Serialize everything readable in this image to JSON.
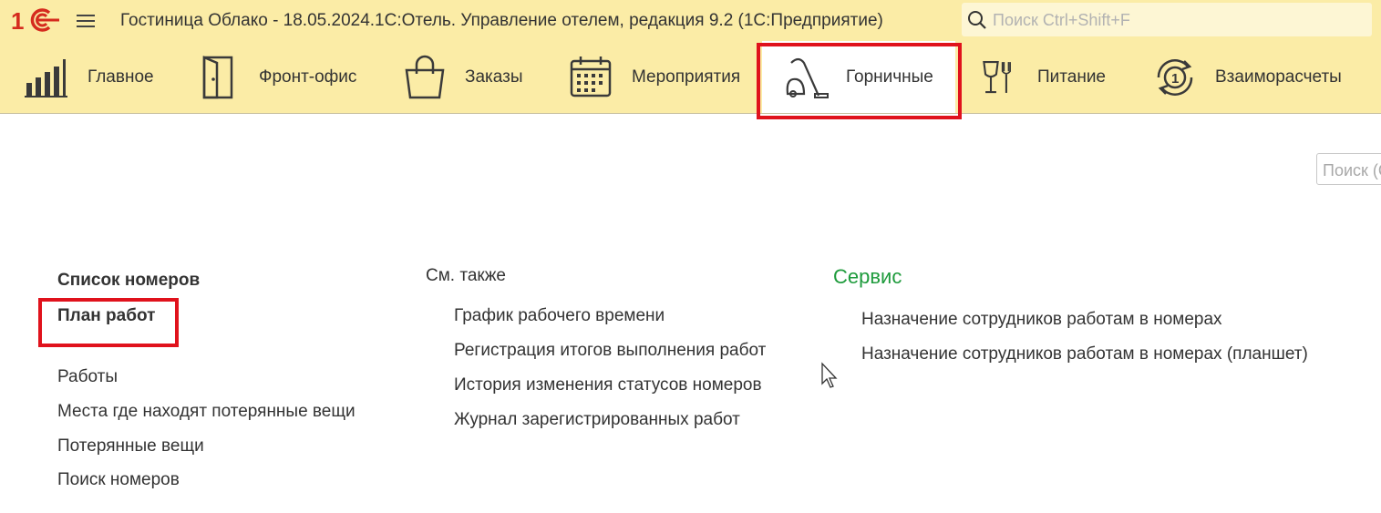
{
  "titlebar": {
    "title": "Гостиница Облако - 18.05.2024.1С:Отель. Управление отелем, редакция 9.2  (1С:Предприятие)",
    "logo_icon": "1c-logo-icon",
    "menu_icon": "hamburger-menu-icon",
    "search_placeholder": "Поиск Ctrl+Shift+F",
    "search_value": ""
  },
  "sections": [
    {
      "label": "Главное",
      "icon": "bar-chart-icon",
      "active": false
    },
    {
      "label": "Фронт-офис",
      "icon": "door-icon",
      "active": false
    },
    {
      "label": "Заказы",
      "icon": "shopping-bag-icon",
      "active": false
    },
    {
      "label": "Мероприятия",
      "icon": "calendar-icon",
      "active": false
    },
    {
      "label": "Горничные",
      "icon": "vacuum-cleaner-icon",
      "active": true
    },
    {
      "label": "Питание",
      "icon": "glass-fork-icon",
      "active": false
    },
    {
      "label": "Взаиморасчеты",
      "icon": "cycle-one-icon",
      "active": false
    }
  ],
  "content": {
    "search_placeholder": "Поиск (Ctrl+F)",
    "main_links": {
      "room_list": "Список номеров",
      "work_plan": "План работ",
      "works": "Работы",
      "lost_items_places": "Места где находят потерянные вещи",
      "lost_items": "Потерянные вещи",
      "room_search": "Поиск номеров"
    },
    "see_also": {
      "heading": "См. также",
      "items": [
        "График рабочего времени",
        "Регистрация итогов выполнения работ",
        "История изменения статусов номеров",
        "Журнал зарегистрированных работ"
      ]
    },
    "service": {
      "heading": "Сервис",
      "items": [
        "Назначение сотрудников работам в номерах",
        "Назначение сотрудников работам в номерах (планшет)"
      ]
    }
  },
  "colors": {
    "bar_background": "#fbeca6",
    "highlight_red": "#e0121c",
    "logo_red": "#d52b1e",
    "service_green": "#1e9b3c"
  }
}
